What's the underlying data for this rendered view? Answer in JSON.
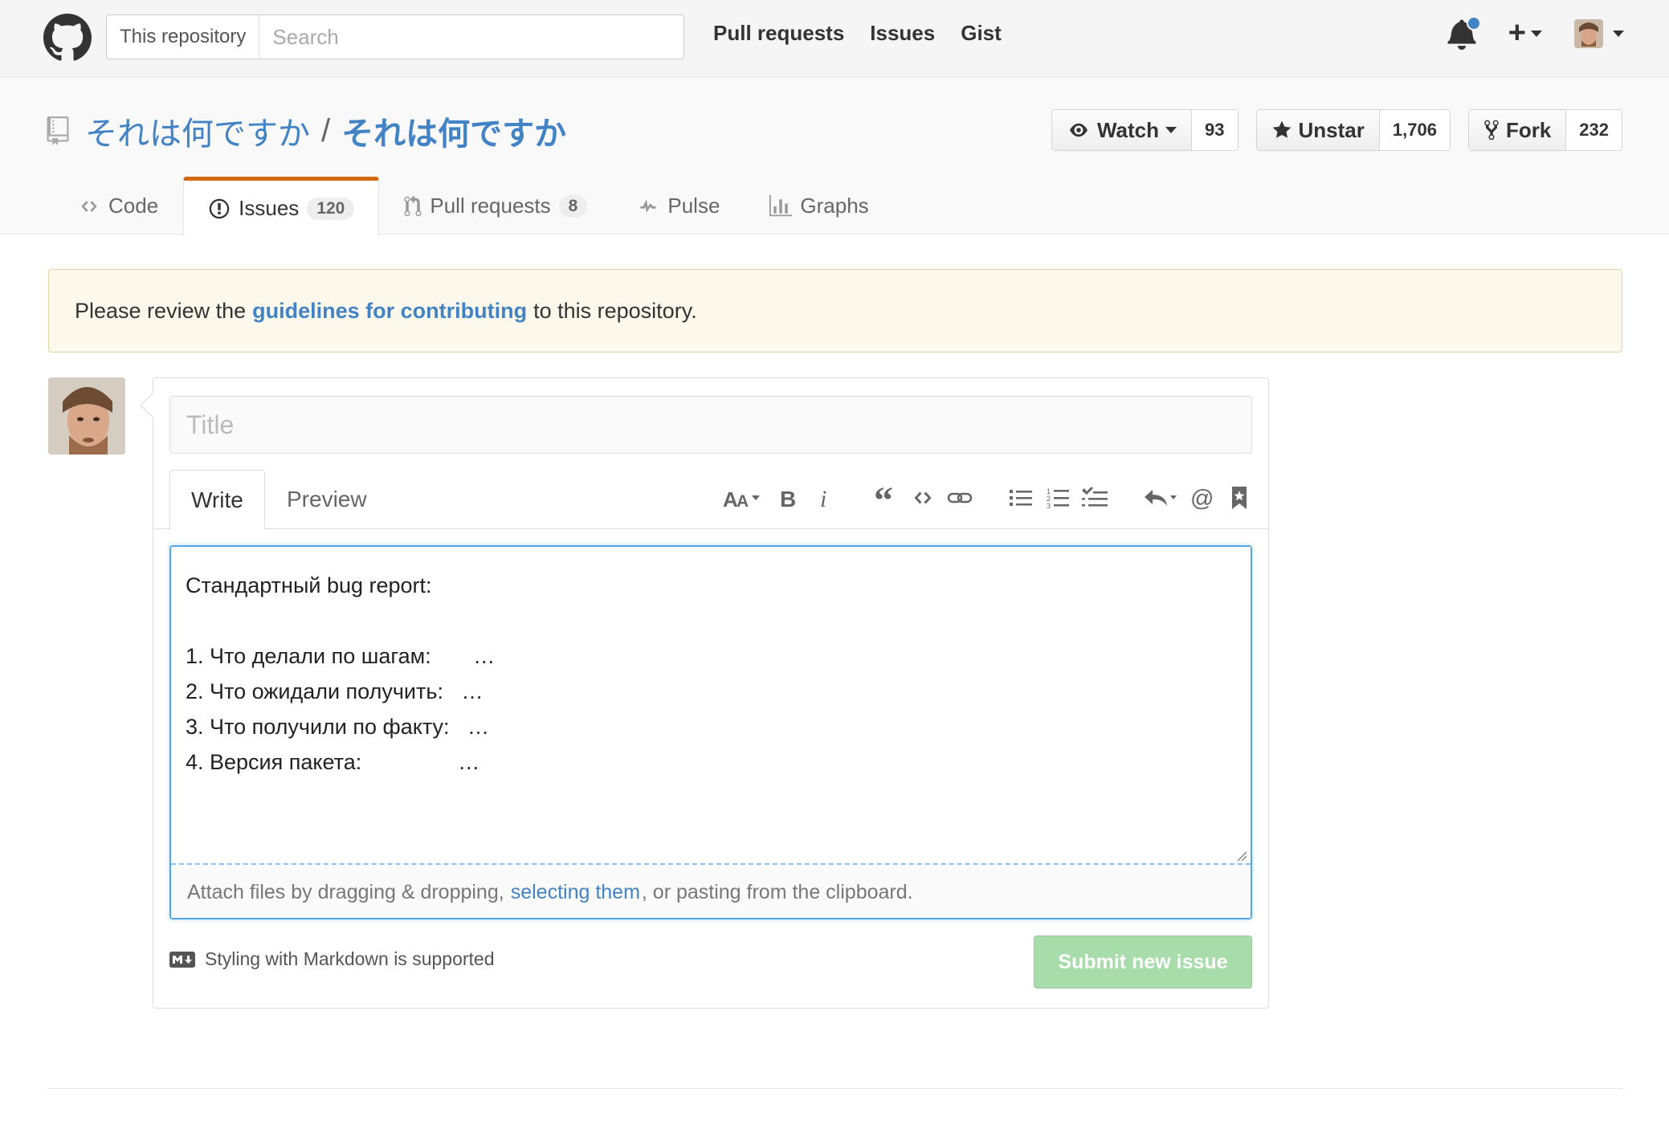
{
  "header": {
    "search_scope": "This repository",
    "search_placeholder": "Search",
    "nav": [
      "Pull requests",
      "Issues",
      "Gist"
    ]
  },
  "repo": {
    "owner": "それは何ですか",
    "separator": "/",
    "name": "それは何ですか",
    "actions": {
      "watch_label": "Watch",
      "watch_count": "93",
      "star_label": "Unstar",
      "star_count": "1,706",
      "fork_label": "Fork",
      "fork_count": "232"
    },
    "tabs": [
      {
        "label": "Code",
        "counter": ""
      },
      {
        "label": "Issues",
        "counter": "120"
      },
      {
        "label": "Pull requests",
        "counter": "8"
      },
      {
        "label": "Pulse",
        "counter": ""
      },
      {
        "label": "Graphs",
        "counter": ""
      }
    ]
  },
  "flash": {
    "before": "Please review the",
    "link": "guidelines for contributing",
    "after": "to this repository."
  },
  "form": {
    "title_placeholder": "Title",
    "tab_write": "Write",
    "tab_preview": "Preview",
    "body": "Стандартный bug report:\n\n1. Что делали по шагам:       …\n2. Что ожидали получить:   …\n3. Что получили по факту:   …\n4. Версия пакета:                …",
    "attach_before": "Attach files by dragging & dropping,",
    "attach_link": "selecting them",
    "attach_after": ", or pasting from the clipboard.",
    "markdown_note": "Styling with Markdown is supported",
    "submit_label": "Submit new issue"
  },
  "colors": {
    "accent": "#4183c4",
    "tab_highlight": "#d26911",
    "submit_disabled": "#a8dcaa",
    "flash_bg": "#fcf8ec",
    "notification_dot": "#4183c4"
  },
  "toolbar_icons": [
    "text-size-icon",
    "bold-icon",
    "italic-icon",
    "quote-icon",
    "code-icon",
    "link-icon",
    "unordered-list-icon",
    "ordered-list-icon",
    "task-list-icon",
    "reply-icon",
    "mention-icon",
    "bookmark-icon"
  ]
}
